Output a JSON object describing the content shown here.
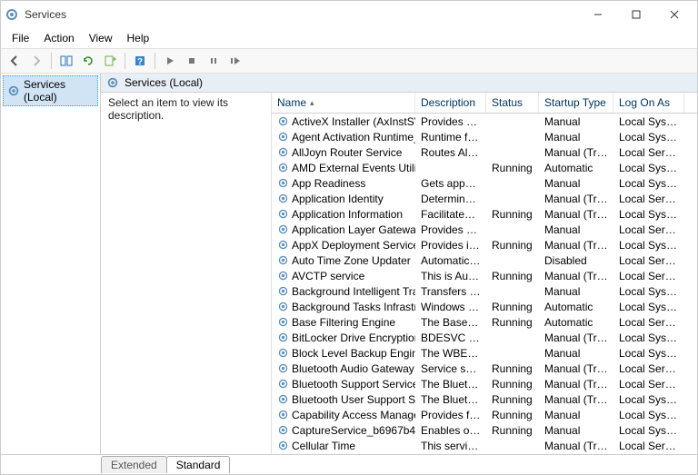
{
  "window": {
    "title": "Services"
  },
  "menu": {
    "file": "File",
    "action": "Action",
    "view": "View",
    "help": "Help"
  },
  "left_pane": {
    "root": "Services (Local)"
  },
  "pane_header": "Services (Local)",
  "description_prompt": "Select an item to view its description.",
  "columns": {
    "name": "Name",
    "description": "Description",
    "status": "Status",
    "startup": "Startup Type",
    "logon": "Log On As"
  },
  "tabs": {
    "extended": "Extended",
    "standard": "Standard"
  },
  "services": [
    {
      "name": "ActiveX Installer (AxInstSV)",
      "desc": "Provides Us...",
      "status": "",
      "startup": "Manual",
      "logon": "Local Syste..."
    },
    {
      "name": "Agent Activation Runtime_...",
      "desc": "Runtime for...",
      "status": "",
      "startup": "Manual",
      "logon": "Local Syste..."
    },
    {
      "name": "AllJoyn Router Service",
      "desc": "Routes AllJo...",
      "status": "",
      "startup": "Manual (Trig...",
      "logon": "Local Service"
    },
    {
      "name": "AMD External Events Utility",
      "desc": "",
      "status": "Running",
      "startup": "Automatic",
      "logon": "Local Syste..."
    },
    {
      "name": "App Readiness",
      "desc": "Gets apps re...",
      "status": "",
      "startup": "Manual",
      "logon": "Local Syste..."
    },
    {
      "name": "Application Identity",
      "desc": "Determines ...",
      "status": "",
      "startup": "Manual (Trig...",
      "logon": "Local Service"
    },
    {
      "name": "Application Information",
      "desc": "Facilitates t...",
      "status": "Running",
      "startup": "Manual (Trig...",
      "logon": "Local Syste..."
    },
    {
      "name": "Application Layer Gateway ...",
      "desc": "Provides su...",
      "status": "",
      "startup": "Manual",
      "logon": "Local Service"
    },
    {
      "name": "AppX Deployment Service (...",
      "desc": "Provides inf...",
      "status": "Running",
      "startup": "Manual (Trig...",
      "logon": "Local Syste..."
    },
    {
      "name": "Auto Time Zone Updater",
      "desc": "Automatica...",
      "status": "",
      "startup": "Disabled",
      "logon": "Local Service"
    },
    {
      "name": "AVCTP service",
      "desc": "This is Audi...",
      "status": "Running",
      "startup": "Manual (Trig...",
      "logon": "Local Service"
    },
    {
      "name": "Background Intelligent Tran...",
      "desc": "Transfers fil...",
      "status": "",
      "startup": "Manual",
      "logon": "Local Syste..."
    },
    {
      "name": "Background Tasks Infrastruc...",
      "desc": "Windows in...",
      "status": "Running",
      "startup": "Automatic",
      "logon": "Local Syste..."
    },
    {
      "name": "Base Filtering Engine",
      "desc": "The Base Fil...",
      "status": "Running",
      "startup": "Automatic",
      "logon": "Local Service"
    },
    {
      "name": "BitLocker Drive Encryption ...",
      "desc": "BDESVC hos...",
      "status": "",
      "startup": "Manual (Trig...",
      "logon": "Local Syste..."
    },
    {
      "name": "Block Level Backup Engine ...",
      "desc": "The WBENG...",
      "status": "",
      "startup": "Manual",
      "logon": "Local Syste..."
    },
    {
      "name": "Bluetooth Audio Gateway S...",
      "desc": "Service sup...",
      "status": "Running",
      "startup": "Manual (Trig...",
      "logon": "Local Service"
    },
    {
      "name": "Bluetooth Support Service",
      "desc": "The Bluetoo...",
      "status": "Running",
      "startup": "Manual (Trig...",
      "logon": "Local Service"
    },
    {
      "name": "Bluetooth User Support Ser...",
      "desc": "The Bluetoo...",
      "status": "Running",
      "startup": "Manual (Trig...",
      "logon": "Local Syste..."
    },
    {
      "name": "Capability Access Manager ...",
      "desc": "Provides fac...",
      "status": "Running",
      "startup": "Manual",
      "logon": "Local Syste..."
    },
    {
      "name": "CaptureService_b6967b4",
      "desc": "Enables opti...",
      "status": "Running",
      "startup": "Manual",
      "logon": "Local Syste..."
    },
    {
      "name": "Cellular Time",
      "desc": "This service ...",
      "status": "",
      "startup": "Manual (Trig...",
      "logon": "Local Service"
    }
  ]
}
